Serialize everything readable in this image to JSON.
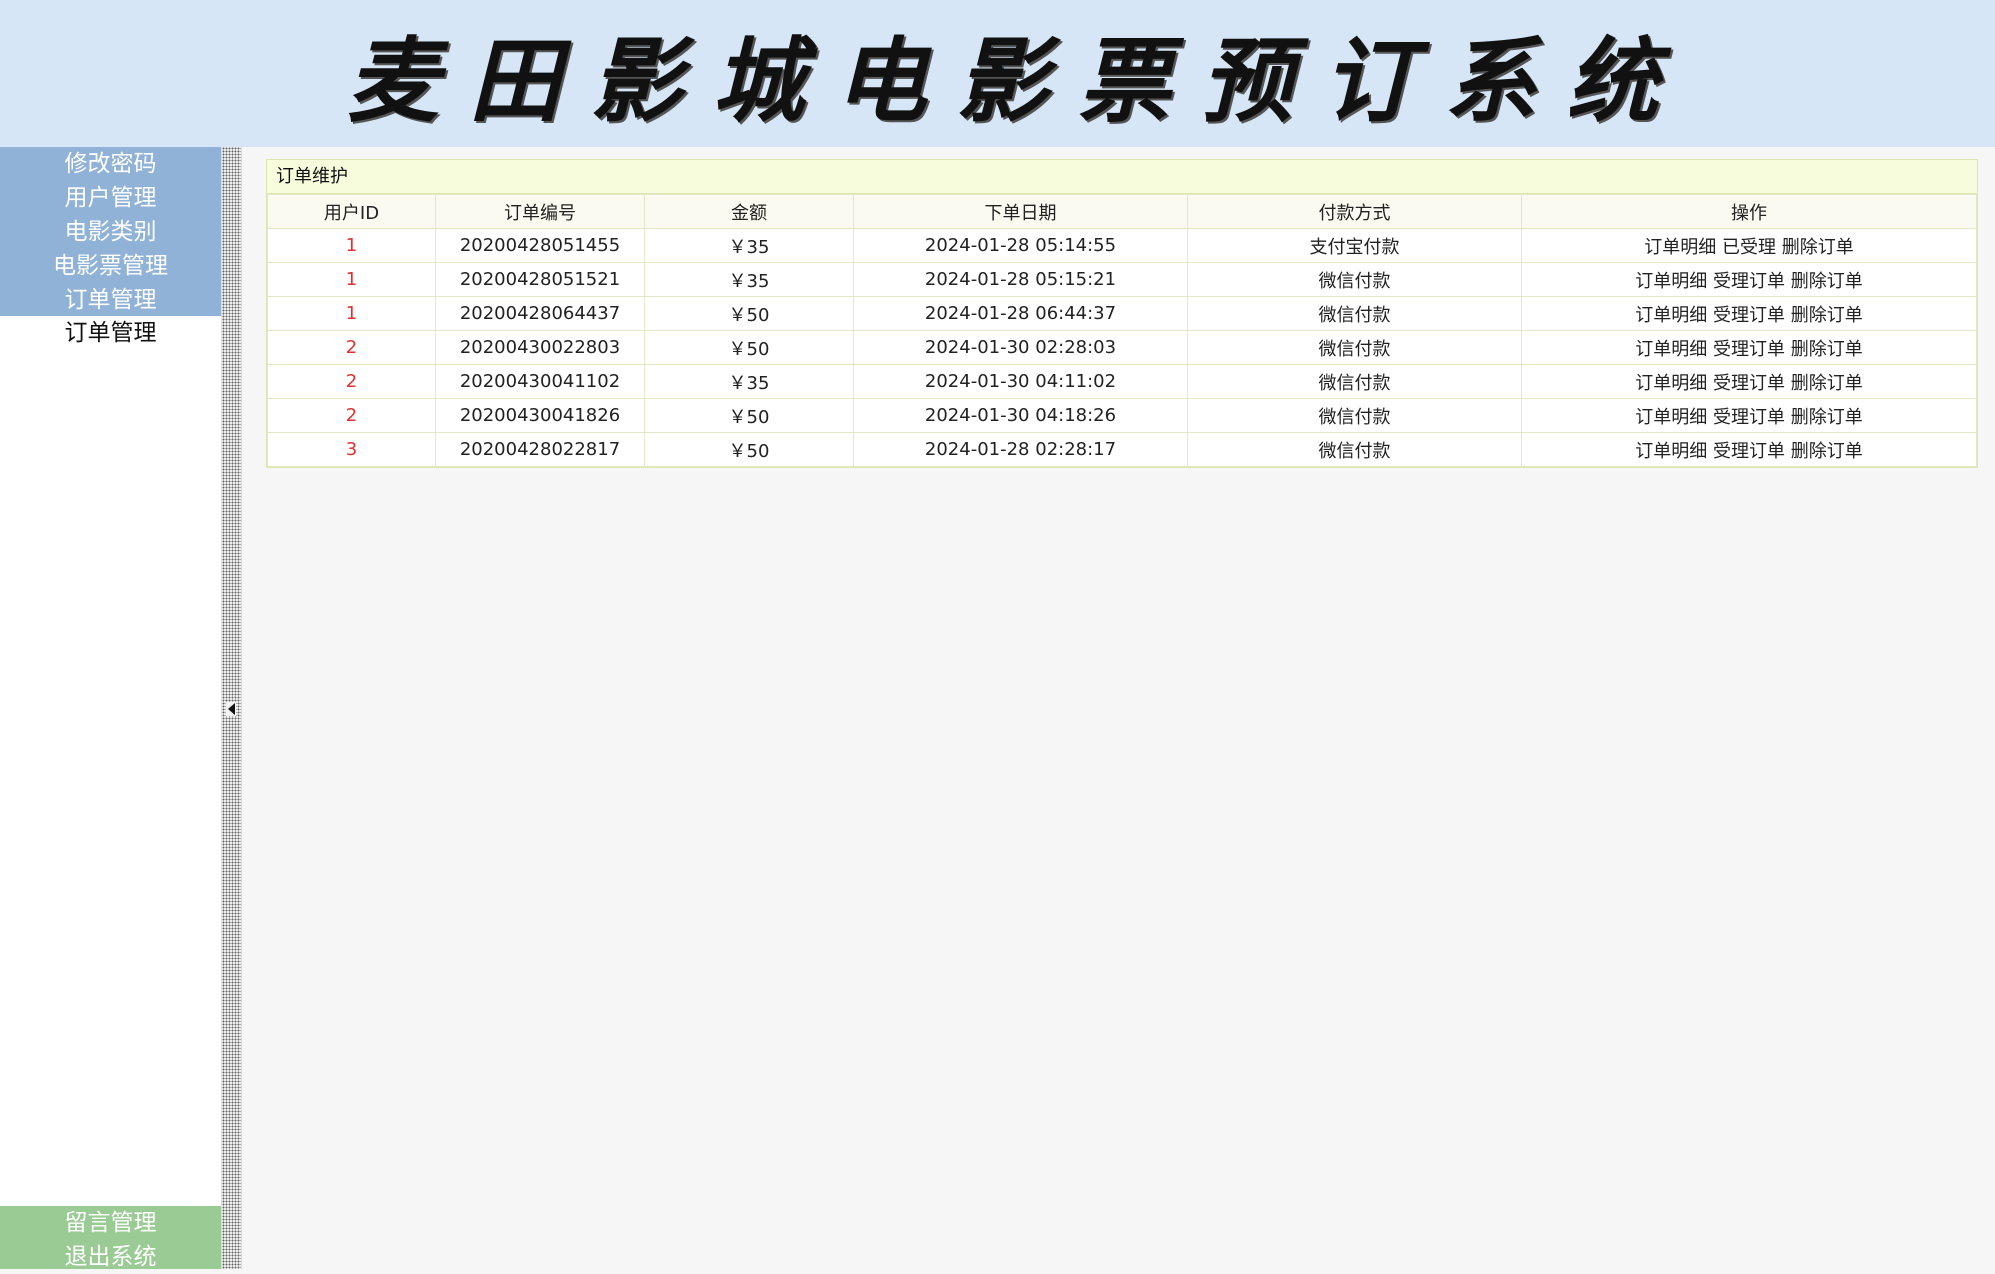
{
  "header": {
    "title": "麦田影城电影票预订系统"
  },
  "sidebar": {
    "top_items": [
      {
        "label": "修改密码"
      },
      {
        "label": "用户管理"
      },
      {
        "label": "电影类别"
      },
      {
        "label": "电影票管理"
      },
      {
        "label": "订单管理"
      }
    ],
    "sub_items": [
      {
        "label": "订单管理"
      }
    ],
    "bottom_items": [
      {
        "label": "留言管理"
      },
      {
        "label": "退出系统"
      }
    ]
  },
  "panel": {
    "title": "订单维护",
    "columns": [
      "用户ID",
      "订单编号",
      "金额",
      "下单日期",
      "付款方式",
      "操作"
    ],
    "rows": [
      {
        "uid": "1",
        "order_no": "20200428051455",
        "amount": "￥35",
        "date": "2024-01-28 05:14:55",
        "payment": "支付宝付款",
        "a1": "订单明细",
        "a2": "已受理",
        "a3": "删除订单"
      },
      {
        "uid": "1",
        "order_no": "20200428051521",
        "amount": "￥35",
        "date": "2024-01-28 05:15:21",
        "payment": "微信付款",
        "a1": "订单明细",
        "a2": "受理订单",
        "a3": "删除订单"
      },
      {
        "uid": "1",
        "order_no": "20200428064437",
        "amount": "￥50",
        "date": "2024-01-28 06:44:37",
        "payment": "微信付款",
        "a1": "订单明细",
        "a2": "受理订单",
        "a3": "删除订单"
      },
      {
        "uid": "2",
        "order_no": "20200430022803",
        "amount": "￥50",
        "date": "2024-01-30 02:28:03",
        "payment": "微信付款",
        "a1": "订单明细",
        "a2": "受理订单",
        "a3": "删除订单"
      },
      {
        "uid": "2",
        "order_no": "20200430041102",
        "amount": "￥35",
        "date": "2024-01-30 04:11:02",
        "payment": "微信付款",
        "a1": "订单明细",
        "a2": "受理订单",
        "a3": "删除订单"
      },
      {
        "uid": "2",
        "order_no": "20200430041826",
        "amount": "￥50",
        "date": "2024-01-30 04:18:26",
        "payment": "微信付款",
        "a1": "订单明细",
        "a2": "受理订单",
        "a3": "删除订单"
      },
      {
        "uid": "3",
        "order_no": "20200428022817",
        "amount": "￥50",
        "date": "2024-01-28 02:28:17",
        "payment": "微信付款",
        "a1": "订单明细",
        "a2": "受理订单",
        "a3": "删除订单"
      }
    ]
  },
  "colors": {
    "header_bg": "#d6e6f7",
    "menu_blue": "#8fb2d6",
    "menu_green": "#9acb94",
    "uid_red": "#e03030",
    "panel_title_bg": "#f7fcdc"
  }
}
